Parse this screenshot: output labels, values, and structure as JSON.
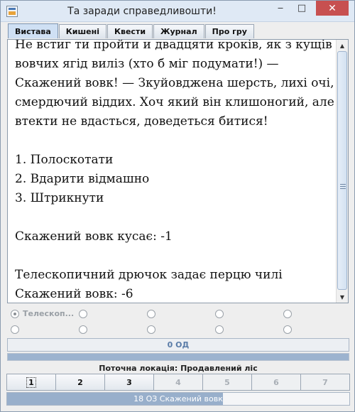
{
  "window": {
    "title": "Та заради справедливошти!",
    "minimize_glyph": "‒",
    "maximize_glyph": "□",
    "close_glyph": "✕"
  },
  "tabs": [
    {
      "label": "Вистава",
      "active": true
    },
    {
      "label": "Кишені",
      "active": false
    },
    {
      "label": "Квести",
      "active": false
    },
    {
      "label": "Журнал",
      "active": false
    },
    {
      "label": "Про гру",
      "active": false
    }
  ],
  "story": {
    "text": "Не встиг ти пройти и двадцяти кроків, як з кущів\nвовчих ягід виліз (хто б міг подумати!) —\nСкажений вовк! — Зкуйовджена шерсть, лихі очі,\nсмердючий віддих. Хоч який він клишоногий, але\nвтекти не вдасться, доведеться битися!\n\n1. Полоскотати\n2. Вдарити відмашно\n3. Штрикнути\n\nСкажений вовк кусає: -1\n\nТелескопичний дрючок задає перцю чилі\nСкажений вовк: -6"
  },
  "choices": {
    "row1": [
      {
        "label": "Телескоп...",
        "selected": true
      },
      {
        "label": ""
      },
      {
        "label": ""
      },
      {
        "label": ""
      },
      {
        "label": ""
      }
    ],
    "row2": [
      {
        "label": ""
      },
      {
        "label": ""
      },
      {
        "label": ""
      },
      {
        "label": ""
      },
      {
        "label": ""
      }
    ]
  },
  "action_points": {
    "label": "0 ОД"
  },
  "location": {
    "label": "Поточна локація: Продавлений ліс"
  },
  "pages": [
    {
      "label": "1",
      "current": true,
      "enabled": true
    },
    {
      "label": "2",
      "current": false,
      "enabled": true
    },
    {
      "label": "3",
      "current": false,
      "enabled": true
    },
    {
      "label": "4",
      "current": false,
      "enabled": false
    },
    {
      "label": "5",
      "current": false,
      "enabled": false
    },
    {
      "label": "6",
      "current": false,
      "enabled": false
    },
    {
      "label": "7",
      "current": false,
      "enabled": false
    }
  ],
  "enemy_health": {
    "label": "18 ОЗ Скажений вовк",
    "fraction": 0.63
  },
  "colors": {
    "accent": "#98afcb",
    "tab_active": "#cfe0f4",
    "close": "#c75050"
  }
}
